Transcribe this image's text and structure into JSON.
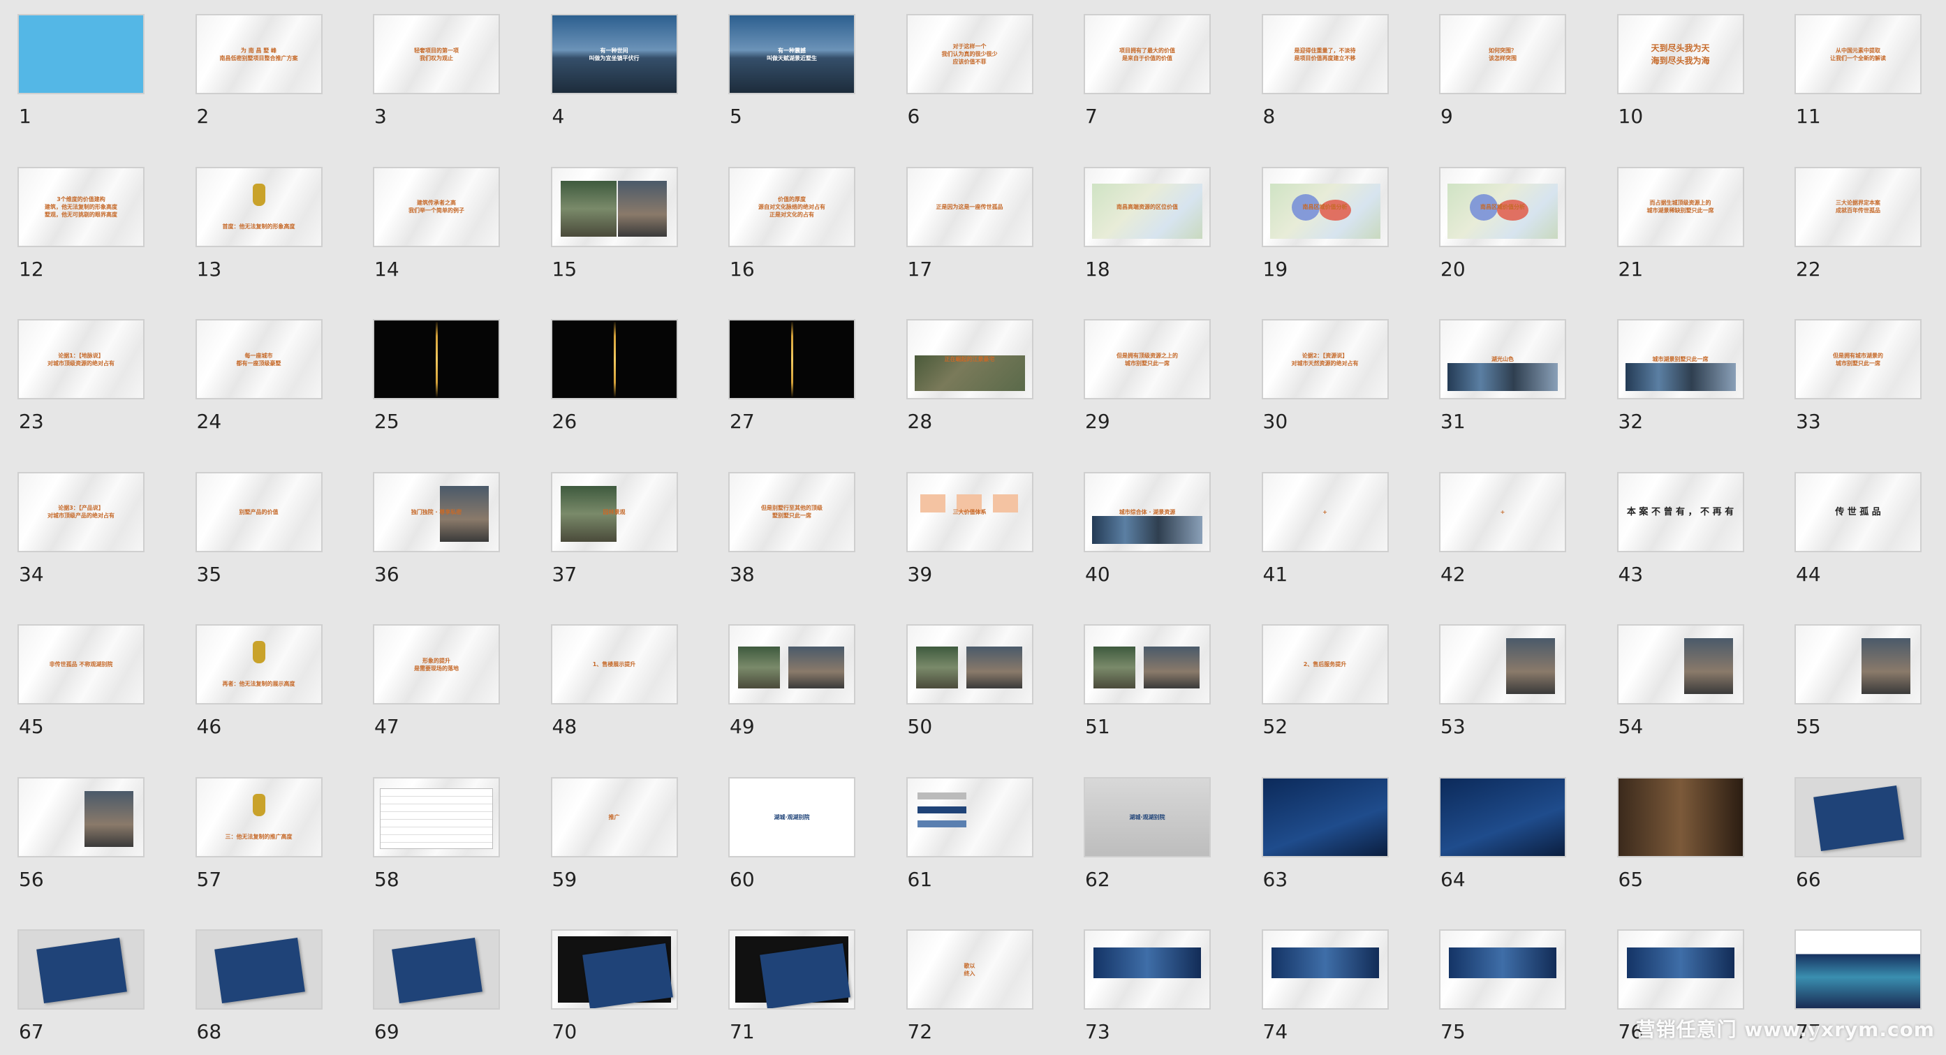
{
  "watermark": "营销任意门 www.yxrym.com",
  "slides": [
    {
      "n": "1",
      "style": "blue",
      "lines": []
    },
    {
      "n": "2",
      "style": "text",
      "lines": [
        "为 南 昌 墅 峰",
        "南昌低密别墅项目整合推广方案"
      ]
    },
    {
      "n": "3",
      "style": "text",
      "lines": [
        "轻奢项目的第一项",
        "我们叹为观止"
      ]
    },
    {
      "n": "4",
      "style": "photo",
      "lines": [
        "有一种世间",
        "叫做为宜坐镇平伏行"
      ]
    },
    {
      "n": "5",
      "style": "photo",
      "lines": [
        "有一种震撼",
        "叫做天赋湖景近墅生"
      ]
    },
    {
      "n": "6",
      "style": "text",
      "lines": [
        "对于这样一个",
        "我们认为真的很少很少",
        "应该价值不菲"
      ]
    },
    {
      "n": "7",
      "style": "text",
      "lines": [
        "项目拥有了最大的价值",
        "是来自于价值的价值"
      ]
    },
    {
      "n": "8",
      "style": "text",
      "lines": [
        "是迎得住重量了，不淡待",
        "是项目价值再度建立不移"
      ]
    },
    {
      "n": "9",
      "style": "text",
      "lines": [
        "如何突围？",
        "该怎样突围"
      ]
    },
    {
      "n": "10",
      "style": "quote",
      "lines": [
        "天到尽头我为天",
        "海到尽头我为海"
      ]
    },
    {
      "n": "11",
      "style": "text",
      "lines": [
        "从中国元素中提取",
        "让我们一个全新的解读"
      ]
    },
    {
      "n": "12",
      "style": "text",
      "lines": [
        "3个维度的价值建构",
        "建筑，他无法复制的形象高度",
        "墅观，他无可挑剔的眼界高度"
      ]
    },
    {
      "n": "13",
      "style": "vase",
      "lines": [
        "首度：他无法复制的形象高度"
      ]
    },
    {
      "n": "14",
      "style": "text",
      "lines": [
        "建筑传承者之高",
        "我们举一个简单的例子"
      ]
    },
    {
      "n": "15",
      "style": "vases",
      "lines": []
    },
    {
      "n": "16",
      "style": "text",
      "lines": [
        "价值的厚度",
        "源自对文化脉络的绝对占有",
        "正是对文化的占有"
      ]
    },
    {
      "n": "17",
      "style": "text",
      "lines": [
        "正是因为这是一座传世孤品"
      ]
    },
    {
      "n": "18",
      "style": "map",
      "lines": [
        "南昌高端资源的区位价值"
      ]
    },
    {
      "n": "19",
      "style": "map2",
      "lines": [
        "南昌区域价值分析"
      ]
    },
    {
      "n": "20",
      "style": "map2",
      "lines": [
        "南昌区域价值分析"
      ]
    },
    {
      "n": "21",
      "style": "text",
      "lines": [
        "而占据生城顶级资源上的",
        "城市湖景稀缺别墅只此一席"
      ]
    },
    {
      "n": "22",
      "style": "text",
      "lines": [
        "三大论据界定本案",
        "成就百年传世孤品"
      ]
    },
    {
      "n": "23",
      "style": "text",
      "lines": [
        "论据1：【地脉说】",
        "对城市顶级资源的绝对占有"
      ]
    },
    {
      "n": "24",
      "style": "text",
      "lines": [
        "每一座城市",
        "都有一座顶级豪墅"
      ]
    },
    {
      "n": "25",
      "style": "dark",
      "lines": []
    },
    {
      "n": "26",
      "style": "dark",
      "lines": []
    },
    {
      "n": "27",
      "style": "dark",
      "lines": []
    },
    {
      "n": "28",
      "style": "aerial",
      "lines": [
        "正在崛起的江景豪宅"
      ]
    },
    {
      "n": "29",
      "style": "text",
      "lines": [
        "但是拥有顶级资源之上的",
        "城市别墅只此一席"
      ]
    },
    {
      "n": "30",
      "style": "text",
      "lines": [
        "论据2：【资源说】",
        "对城市天然资源的绝对占有"
      ]
    },
    {
      "n": "31",
      "style": "strip",
      "lines": [
        "湖光山色"
      ]
    },
    {
      "n": "32",
      "style": "strip2",
      "lines": [
        "城市湖景别墅只此一席"
      ]
    },
    {
      "n": "33",
      "style": "text",
      "lines": [
        "但是拥有城市湖景的",
        "城市别墅只此一席"
      ]
    },
    {
      "n": "34",
      "style": "text",
      "lines": [
        "论据3：【产品说】",
        "对城市顶级产品的绝对占有"
      ]
    },
    {
      "n": "35",
      "style": "text",
      "lines": [
        "别墅产品的价值"
      ]
    },
    {
      "n": "36",
      "style": "house",
      "lines": [
        "独门独院 · 尊享私密"
      ]
    },
    {
      "n": "37",
      "style": "housel",
      "lines": [
        "园林景观"
      ]
    },
    {
      "n": "38",
      "style": "text",
      "lines": [
        "但是别墅行至其他的顶级",
        "墅别墅只此一席"
      ]
    },
    {
      "n": "39",
      "style": "boxes",
      "lines": [
        "三大价值体系"
      ]
    },
    {
      "n": "40",
      "style": "strip",
      "lines": [
        "城市综合体 · 湖景资源"
      ]
    },
    {
      "n": "41",
      "style": "plus",
      "lines": [
        "+"
      ]
    },
    {
      "n": "42",
      "style": "plus",
      "lines": [
        "+"
      ]
    },
    {
      "n": "43",
      "style": "bold",
      "lines": [
        "本 案 不 曾 有 ， 不 再 有"
      ]
    },
    {
      "n": "44",
      "style": "bold",
      "lines": [
        "传 世 孤 品"
      ]
    },
    {
      "n": "45",
      "style": "text",
      "lines": [
        "非传世孤品 不称观湖别院"
      ]
    },
    {
      "n": "46",
      "style": "vase",
      "lines": [
        "再者：他无法复制的展示高度"
      ]
    },
    {
      "n": "47",
      "style": "text",
      "lines": [
        "形象的提升",
        "是需要现场的落地"
      ]
    },
    {
      "n": "48",
      "style": "text",
      "lines": [
        "1、售楼展示提升"
      ]
    },
    {
      "n": "49",
      "style": "photos",
      "lines": []
    },
    {
      "n": "50",
      "style": "photos",
      "lines": []
    },
    {
      "n": "51",
      "style": "photos",
      "lines": []
    },
    {
      "n": "52",
      "style": "text",
      "lines": [
        "2、售后服务提升"
      ]
    },
    {
      "n": "53",
      "style": "photoR",
      "lines": []
    },
    {
      "n": "54",
      "style": "photoR",
      "lines": []
    },
    {
      "n": "55",
      "style": "photoR",
      "lines": []
    },
    {
      "n": "56",
      "style": "photoR",
      "lines": []
    },
    {
      "n": "57",
      "style": "vase",
      "lines": [
        "三：他无法复制的推广高度"
      ]
    },
    {
      "n": "58",
      "style": "table",
      "lines": []
    },
    {
      "n": "59",
      "style": "text",
      "lines": [
        "推广"
      ]
    },
    {
      "n": "60",
      "style": "white",
      "lines": [
        "湖城·观湖别院"
      ]
    },
    {
      "n": "61",
      "style": "swatch",
      "lines": []
    },
    {
      "n": "62",
      "style": "grey",
      "lines": [
        "湖城·观湖别院"
      ]
    },
    {
      "n": "63",
      "style": "navy",
      "lines": []
    },
    {
      "n": "64",
      "style": "navy",
      "lines": []
    },
    {
      "n": "65",
      "style": "brown",
      "lines": []
    },
    {
      "n": "66",
      "style": "card",
      "lines": []
    },
    {
      "n": "67",
      "style": "card",
      "lines": []
    },
    {
      "n": "68",
      "style": "card",
      "lines": []
    },
    {
      "n": "69",
      "style": "card",
      "lines": []
    },
    {
      "n": "70",
      "style": "box",
      "lines": []
    },
    {
      "n": "71",
      "style": "box",
      "lines": []
    },
    {
      "n": "72",
      "style": "text",
      "lines": [
        "歌以",
        "终入"
      ]
    },
    {
      "n": "73",
      "style": "bill",
      "lines": []
    },
    {
      "n": "74",
      "style": "bill",
      "lines": []
    },
    {
      "n": "75",
      "style": "bill",
      "lines": []
    },
    {
      "n": "76",
      "style": "bill",
      "lines": []
    },
    {
      "n": "77",
      "style": "aurora",
      "lines": []
    }
  ]
}
